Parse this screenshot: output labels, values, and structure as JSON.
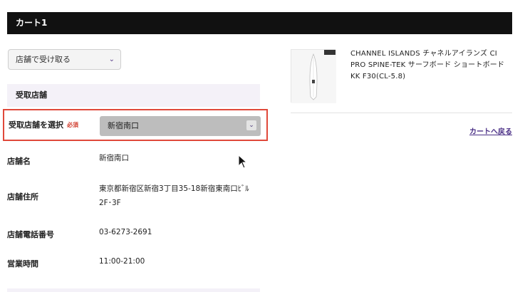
{
  "cart": {
    "title": "カート1"
  },
  "pickup_method": {
    "selected": "店舗で受け取る"
  },
  "pickup_store": {
    "section_title": "受取店舗",
    "select_label": "受取店舗を選択",
    "required_badge": "必須",
    "selected_store": "新宿南口"
  },
  "store_info": {
    "name_label": "店舗名",
    "name_value": "新宿南口",
    "address_label": "店舗住所",
    "address_value": "東京都新宿区新宿3丁目35-18新宿東南口ﾋﾞﾙ2F･3F",
    "phone_label": "店舗電話番号",
    "phone_value": "03-6273-2691",
    "hours_label": "営業時間",
    "hours_value": "11:00-21:00"
  },
  "product": {
    "name": "CHANNEL ISLANDS チャネルアイランズ CI PRO SPINE-TEK サーフボード ショートボード KK F30(CL-5.8)",
    "icon": "surfboard-thumbnail"
  },
  "back_link": {
    "label": "カートへ戻る"
  },
  "colors": {
    "header_bg": "#111111",
    "accent": "#4a2f86",
    "highlight_border": "#e0483a",
    "required": "#d03a2a"
  }
}
